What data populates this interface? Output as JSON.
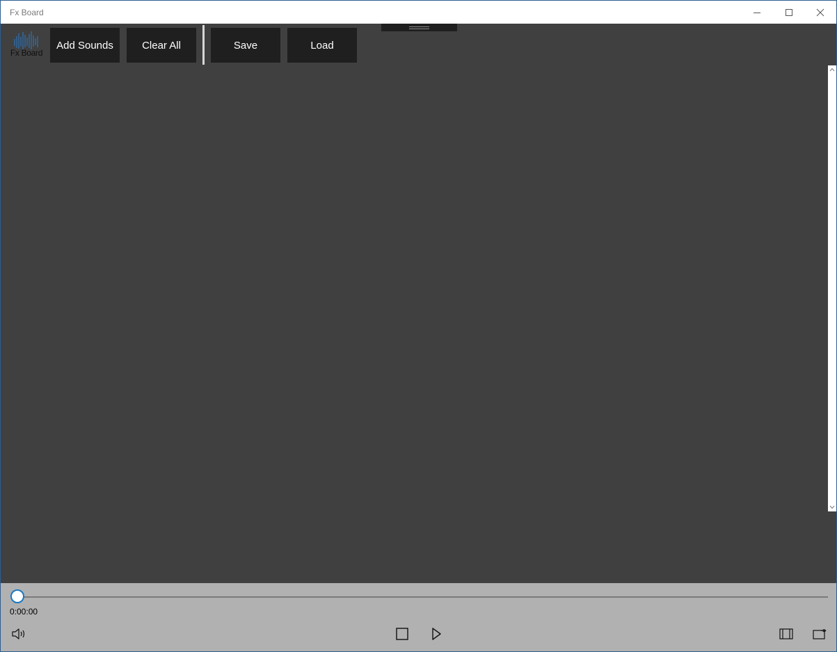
{
  "window": {
    "title": "Fx Board"
  },
  "logo": {
    "text": "Fx Board",
    "icon": "waveform-icon",
    "color": "#2d6fb0"
  },
  "toolbar": {
    "add_sounds_label": "Add Sounds",
    "clear_all_label": "Clear All",
    "save_label": "Save",
    "load_label": "Load"
  },
  "player": {
    "time": "0:00:00",
    "progress": 0,
    "accent": "#1a78c2"
  },
  "colors": {
    "background": "#404040",
    "button": "#1f1f1f",
    "player_bar": "#b1b1b1"
  }
}
